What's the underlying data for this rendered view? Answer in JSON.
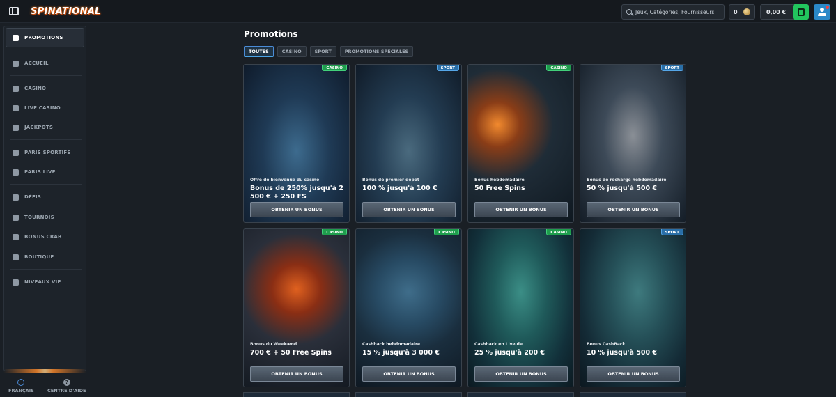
{
  "header": {
    "logo_text": "SPINATIONAL",
    "search_placeholder": "Jeux, Catégories, Fournisseurs",
    "coins": "0",
    "balance": "0,00 €"
  },
  "sidebar": {
    "items": [
      {
        "label": "PROMOTIONS",
        "icon": "gift-icon"
      },
      {
        "label": "ACCUEIL",
        "icon": "home-icon"
      },
      {
        "label": "CASINO",
        "icon": "casino-icon"
      },
      {
        "label": "LIVE CASINO",
        "icon": "live-casino-icon"
      },
      {
        "label": "JACKPOTS",
        "icon": "jackpot-icon"
      },
      {
        "label": "PARIS SPORTIFS",
        "icon": "soccer-ball-icon"
      },
      {
        "label": "PARIS LIVE",
        "icon": "live-betting-icon"
      },
      {
        "label": "DÉFIS",
        "icon": "challenge-icon"
      },
      {
        "label": "TOURNOIS",
        "icon": "tournament-icon"
      },
      {
        "label": "BONUS CRAB",
        "icon": "crab-icon"
      },
      {
        "label": "BOUTIQUE",
        "icon": "shop-icon"
      },
      {
        "label": "NIVEAUX VIP",
        "icon": "diamond-icon"
      }
    ],
    "footer": {
      "language": "FRANÇAIS",
      "help": "CENTRE D'AIDE"
    }
  },
  "main": {
    "title": "Promotions",
    "tabs": [
      "TOUTES",
      "CASINO",
      "SPORT",
      "PROMOTIONS SPÉCIALES"
    ],
    "cards": [
      {
        "badge": "CASINO",
        "subtitle": "Offre de bienvenue du casino",
        "title": "Bonus de 250% jusqu'à 2 500 € + 250 FS",
        "button": "OBTENIR UN BONUS"
      },
      {
        "badge": "SPORT",
        "subtitle": "Bonus de premier dépôt",
        "title": "100 % jusqu'à 100 €",
        "button": "OBTENIR UN BONUS"
      },
      {
        "badge": "CASINO",
        "subtitle": "Bonus hebdomadaire",
        "title": "50 Free Spins",
        "button": "OBTENIR UN BONUS"
      },
      {
        "badge": "SPORT",
        "subtitle": "Bonus de recharge hebdomadaire",
        "title": "50 % jusqu'à 500 €",
        "button": "OBTENIR UN BONUS"
      },
      {
        "badge": "CASINO",
        "subtitle": "Bonus du Week-end",
        "title": "700 € + 50 Free Spins",
        "button": "OBTENIR UN BONUS"
      },
      {
        "badge": "CASINO",
        "subtitle": "Cashback hebdomadaire",
        "title": "15 % jusqu'à 3 000 €",
        "button": "OBTENIR UN BONUS"
      },
      {
        "badge": "CASINO",
        "subtitle": "Cashback en Live de",
        "title": "25 % jusqu'à 200 €",
        "button": "OBTENIR UN BONUS"
      },
      {
        "badge": "SPORT",
        "subtitle": "Bonus CashBack",
        "title": "10 % jusqu'à 500 €",
        "button": "OBTENIR UN BONUS"
      }
    ]
  },
  "colors": {
    "background": "#1a1f25",
    "casino_badge": "#1f9d4d",
    "sport_badge": "#2a6fa8",
    "wallet_green": "#22c55e",
    "user_blue": "#2a88c8",
    "accent_orange": "#ff8a2a"
  }
}
